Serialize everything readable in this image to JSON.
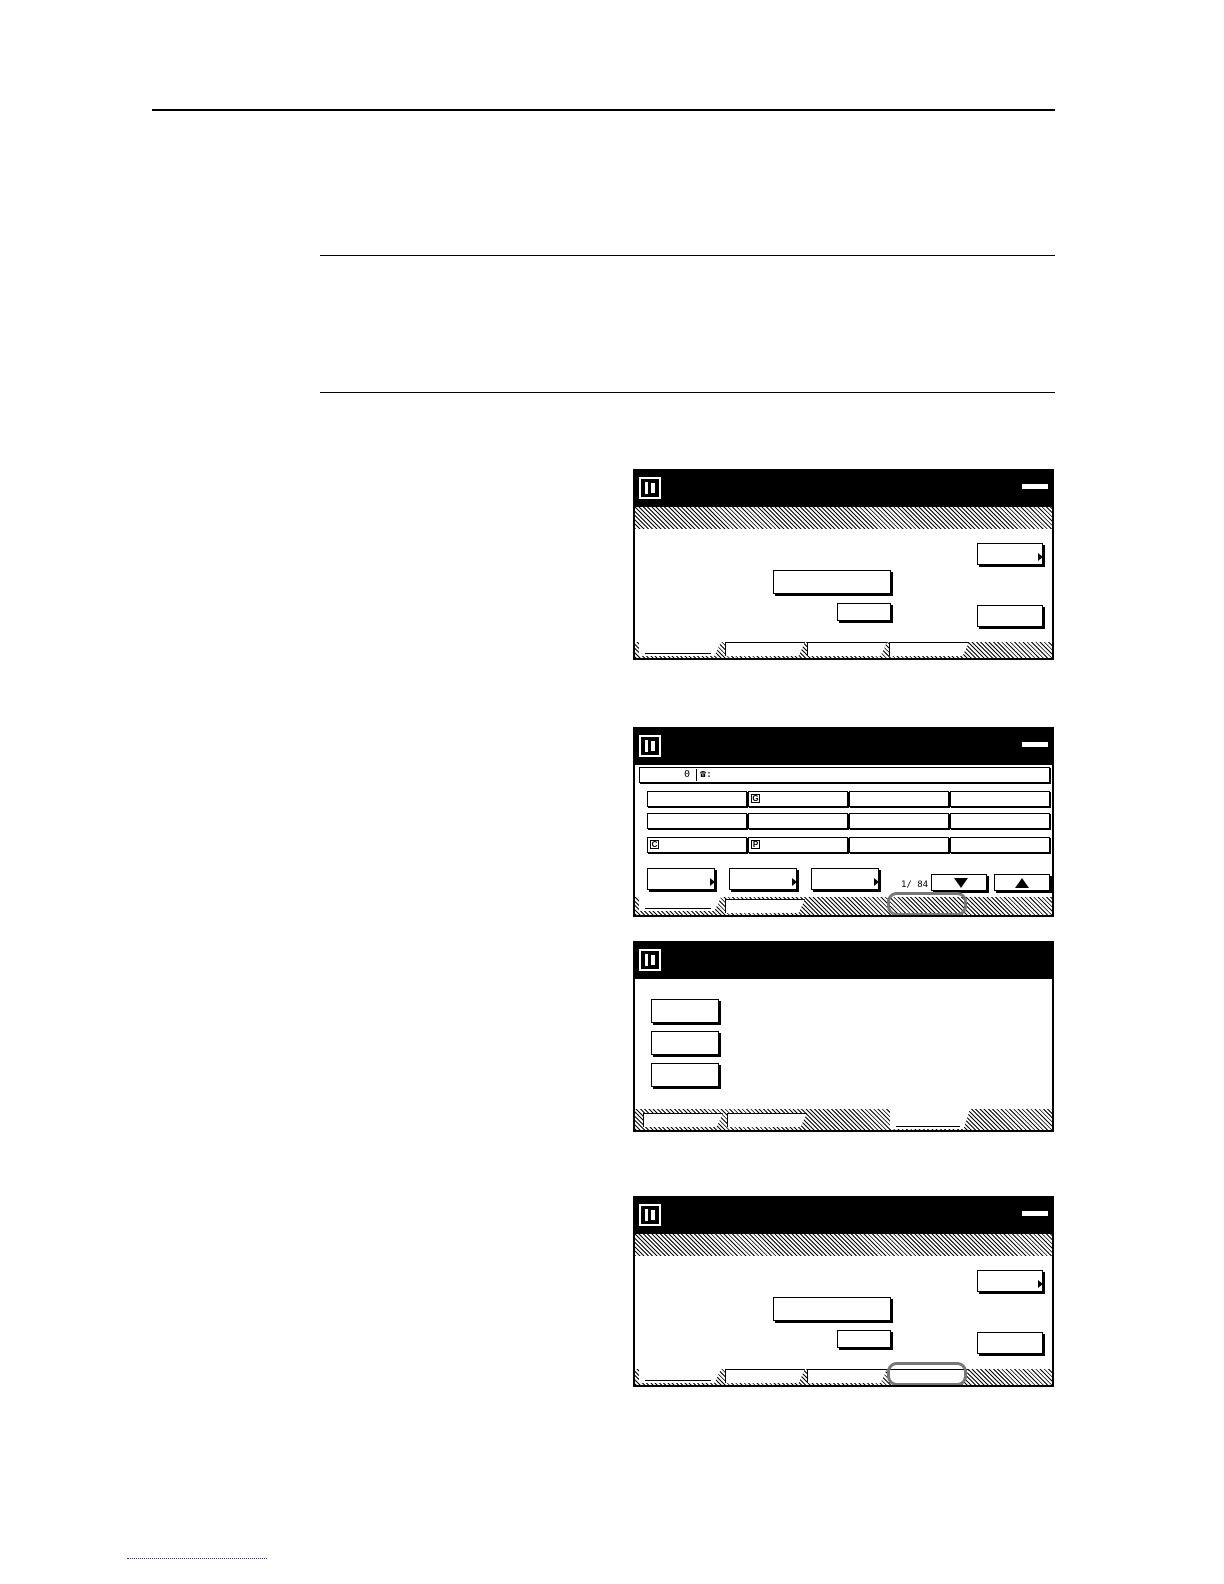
{
  "directory_panel": {
    "info_count": "0",
    "tel_label": "☎:",
    "contact_badges": {
      "group": "G",
      "chain": "C",
      "program": "P"
    },
    "page_indicator": "1/ 84"
  }
}
